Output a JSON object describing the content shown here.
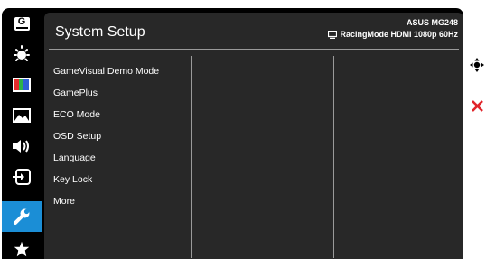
{
  "sidebar": {
    "items": [
      {
        "name": "gamevisual-tab",
        "icon": "g-box-icon",
        "label": "G"
      },
      {
        "name": "brightness-tab",
        "icon": "sun-icon"
      },
      {
        "name": "color-tab",
        "icon": "color-bars-icon"
      },
      {
        "name": "image-tab",
        "icon": "landscape-icon"
      },
      {
        "name": "sound-tab",
        "icon": "speaker-icon"
      },
      {
        "name": "input-tab",
        "icon": "input-icon"
      },
      {
        "name": "system-setup-tab",
        "icon": "wrench-icon",
        "active": true
      },
      {
        "name": "favorite-tab",
        "icon": "star-icon"
      }
    ],
    "active_color": "#1b8ed6"
  },
  "header": {
    "title": "System Setup",
    "model": "ASUS MG248",
    "mode": "RacingMode HDMI 1080p 60Hz"
  },
  "menu": {
    "items": [
      "GameVisual Demo Mode",
      "GamePlus",
      "ECO Mode",
      "OSD Setup",
      "Language",
      "Key Lock",
      "More"
    ]
  },
  "controls": {
    "icons": [
      "joystick-icon",
      "close-icon"
    ],
    "close_color": "#e0242a"
  }
}
